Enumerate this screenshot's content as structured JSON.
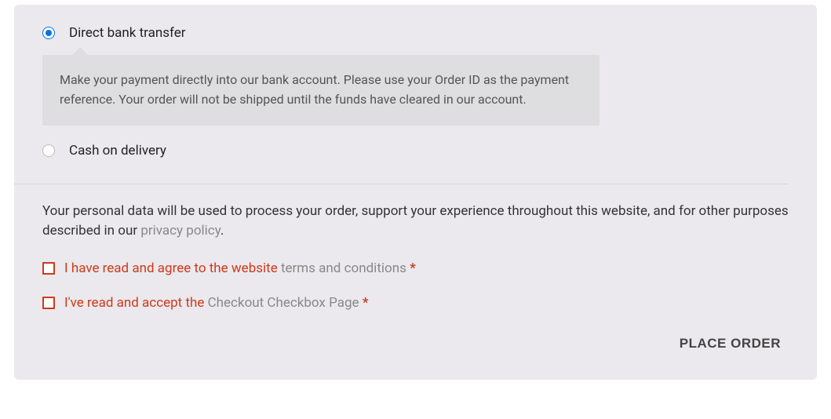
{
  "payment": {
    "bank_transfer": {
      "label": "Direct bank transfer",
      "description": "Make your payment directly into our bank account. Please use your Order ID as the payment reference. Your order will not be shipped until the funds have cleared in our account."
    },
    "cod": {
      "label": "Cash on delivery"
    }
  },
  "privacy": {
    "text_prefix": "Your personal data will be used to process your order, support your experience throughout this website, and for other purposes described in our ",
    "link_text": "privacy policy",
    "text_suffix": "."
  },
  "consent": {
    "terms": {
      "prefix": "I have read and agree to the website ",
      "link": "terms and conditions",
      "required": "*"
    },
    "checkbox_page": {
      "prefix": "I've read and accept the ",
      "link": "Checkout Checkbox Page",
      "required": "*"
    }
  },
  "actions": {
    "place_order": "PLACE ORDER"
  }
}
